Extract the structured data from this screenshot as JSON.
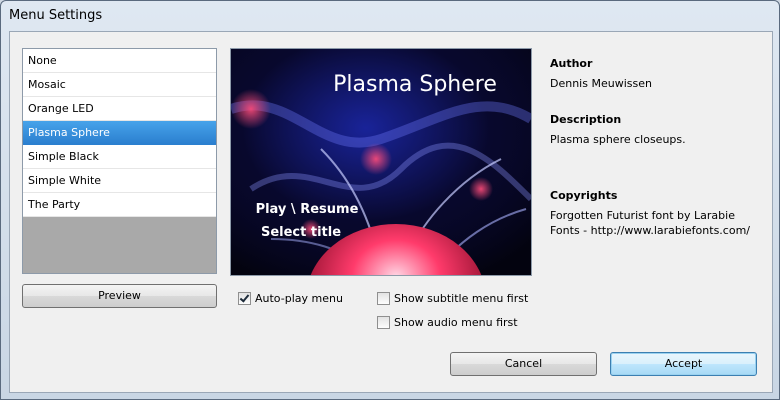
{
  "window": {
    "title": "Menu Settings"
  },
  "menu_list": {
    "items": [
      "None",
      "Mosaic",
      "Orange LED",
      "Plasma Sphere",
      "Simple Black",
      "Simple White",
      "The Party"
    ],
    "selected": "Plasma Sphere"
  },
  "preview": {
    "title": "Plasma Sphere",
    "line1": "Play \\ Resume",
    "line2": "Select title",
    "button_label": "Preview"
  },
  "options": {
    "autoplay": {
      "label": "Auto-play menu",
      "checked": true
    },
    "subtitle_first": {
      "label": "Show subtitle menu first",
      "checked": false
    },
    "audio_first": {
      "label": "Show audio menu first",
      "checked": false
    }
  },
  "info": {
    "author_label": "Author",
    "author": "Dennis Meuwissen",
    "description_label": "Description",
    "description": "Plasma sphere closeups.",
    "copyrights_label": "Copyrights",
    "copyrights": "Forgotten Futurist font by Larabie Fonts - http://www.larabiefonts.com/"
  },
  "buttons": {
    "cancel": "Cancel",
    "accept": "Accept"
  },
  "colors": {
    "selection": "#3a93df",
    "accept_border": "#3c7fb1"
  }
}
